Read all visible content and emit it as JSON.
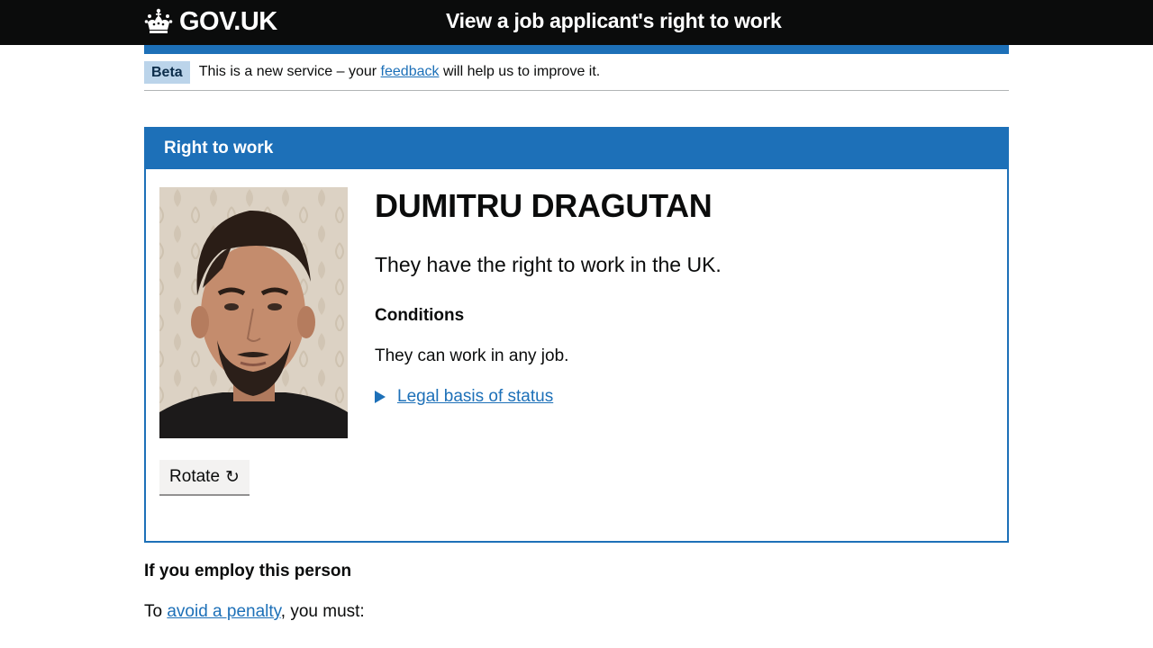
{
  "header": {
    "logo_text": "GOV.UK",
    "logo_icon": "crown-icon",
    "service_name": "View a job applicant's right to work"
  },
  "phase_banner": {
    "tag": "Beta",
    "text_before": "This is a new service – your",
    "link": "feedback",
    "text_after": "will help us to improve it."
  },
  "panel": {
    "heading": "Right to work",
    "name": "DUMITRU DRAGUTAN",
    "status": "They have the right to work in the UK.",
    "conditions_heading": "Conditions",
    "conditions_text": "They can work in any job.",
    "details_summary": "Legal basis of status",
    "rotate_label": "Rotate",
    "rotate_icon": "↻"
  },
  "employ": {
    "heading": "If you employ this person",
    "text_before": "To",
    "link": "avoid a penalty",
    "text_after": ", you must:"
  },
  "colors": {
    "header_bg": "#0b0c0c",
    "brand_blue": "#1d70b8",
    "tag_bg": "#bbd4ea"
  }
}
